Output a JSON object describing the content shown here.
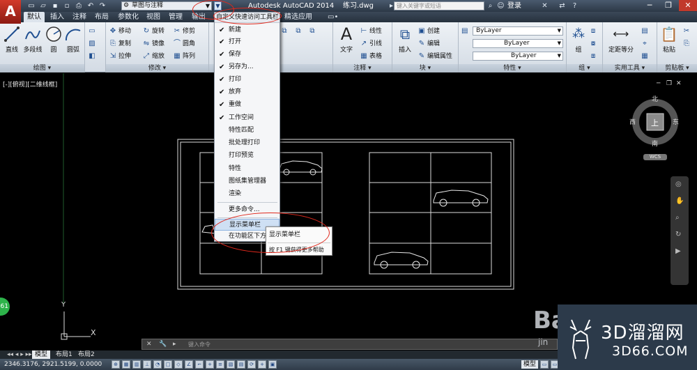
{
  "titlebar": {
    "app_logo": "A",
    "workspace": "草图与注释",
    "window_title": "Autodesk AutoCAD 2014    练习.dwg",
    "search_placeholder": "键入关键字或短语",
    "login": "登录"
  },
  "tabs": [
    "默认",
    "插入",
    "注释",
    "布局",
    "参数化",
    "视图",
    "管理",
    "输出",
    "精选应用"
  ],
  "ribbon": {
    "draw": {
      "title": "绘图",
      "buttons": [
        "直线",
        "多段线",
        "圆",
        "圆弧"
      ]
    },
    "modify": {
      "title": "修改",
      "buttons": [
        "移动",
        "旋转",
        "修剪",
        "复制",
        "镜像",
        "圆角",
        "拉伸",
        "缩放",
        "阵列"
      ]
    },
    "annotation": {
      "title": "注释",
      "big": "文字",
      "buttons": [
        "线性",
        "引线",
        "表格"
      ]
    },
    "block": {
      "title": "块",
      "big": "插入",
      "buttons": [
        "创建",
        "编辑",
        "编辑属性"
      ]
    },
    "properties": {
      "title": "特性",
      "layers": [
        "ByLayer",
        "ByLayer",
        "ByLayer"
      ]
    },
    "group": {
      "title": "组",
      "big": "组"
    },
    "utilities": {
      "title": "实用工具",
      "big": "定距等分"
    },
    "clipboard": {
      "title": "剪贴板",
      "big": "粘贴"
    }
  },
  "qat_menu": {
    "header": "自定义快速访问工具栏",
    "items": [
      {
        "label": "新建",
        "checked": true
      },
      {
        "label": "打开",
        "checked": true
      },
      {
        "label": "保存",
        "checked": true
      },
      {
        "label": "另存为...",
        "checked": true
      },
      {
        "label": "打印",
        "checked": true
      },
      {
        "label": "放弃",
        "checked": true
      },
      {
        "label": "重做",
        "checked": true
      },
      {
        "label": "工作空间",
        "checked": true
      },
      {
        "label": "特性匹配",
        "checked": false
      },
      {
        "label": "批处理打印",
        "checked": false
      },
      {
        "label": "打印预览",
        "checked": false
      },
      {
        "label": "特性",
        "checked": false
      },
      {
        "label": "图纸集管理器",
        "checked": false
      },
      {
        "label": "渲染",
        "checked": false
      }
    ],
    "more": "更多命令...",
    "show_menubar": "显示菜单栏",
    "below_ribbon": "在功能区下方显示"
  },
  "tooltip": {
    "title": "显示菜单栏",
    "help": "按 F1 键获得更多帮助"
  },
  "canvas": {
    "view_label": "[-][俯视][二维线框]",
    "viewcube": {
      "north": "北",
      "south": "南",
      "east": "东",
      "west": "西",
      "top": "上",
      "wcs": "WCS"
    },
    "badge": "61",
    "axis_y": "Y",
    "axis_x": "X"
  },
  "cmdline": {
    "placeholder": "键入命令"
  },
  "layout_tabs": [
    "模型",
    "布局1",
    "布局2"
  ],
  "status": {
    "coords": "2346.3176, 2921.5199, 0.0000",
    "model": "模型"
  },
  "watermark": {
    "cn": "3D溜溜网",
    "en": "3D66.COM",
    "baidu": "Ba",
    "jing": "jin"
  },
  "colors": {
    "accent": "#2c3a4a",
    "annotation": "#e0281c",
    "badge": "#2db34a"
  }
}
